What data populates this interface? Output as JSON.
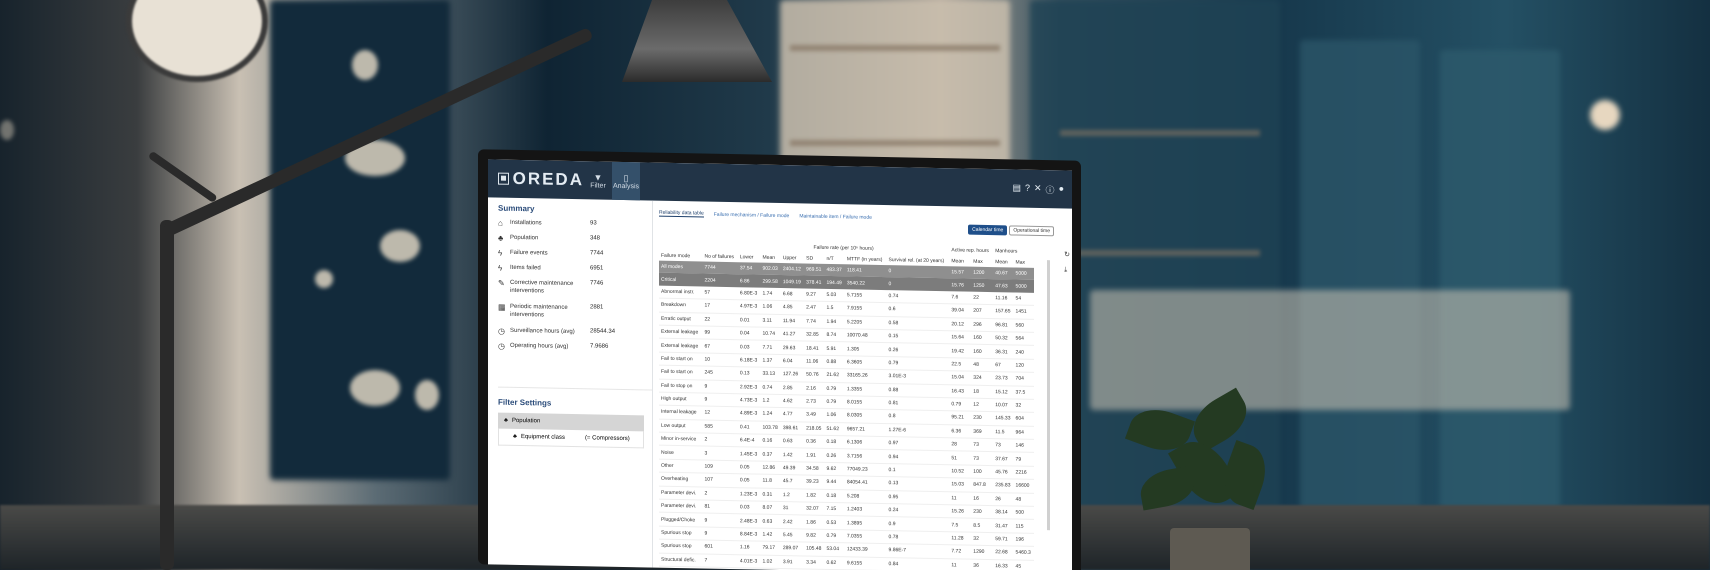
{
  "app": {
    "logo_text": "OREDA"
  },
  "nav": [
    {
      "label": "Filter",
      "icon": "filter-icon",
      "active": false
    },
    {
      "label": "Analysis",
      "icon": "analysis-icon",
      "active": true
    }
  ],
  "summary": {
    "title": "Summary",
    "items": [
      {
        "label": "Installations",
        "value": "93",
        "icon": "installation-icon"
      },
      {
        "label": "Population",
        "value": "348",
        "icon": "population-icon"
      },
      {
        "label": "Failure events",
        "value": "7744",
        "icon": "lightning-icon"
      },
      {
        "label": "Items failed",
        "value": "6951",
        "icon": "lightning-icon"
      },
      {
        "label": "Corrective maintenance interventions",
        "value": "7746",
        "icon": "wrench-icon"
      },
      {
        "label": "Periodic maintenance interventions",
        "value": "2881",
        "icon": "calendar-icon"
      },
      {
        "label": "Surveillance hours (avg)",
        "value": "28544.34",
        "icon": "clock-icon"
      },
      {
        "label": "Operating hours (avg)",
        "value": "7.9686",
        "icon": "clock-icon"
      }
    ]
  },
  "filter_settings": {
    "title": "Filter Settings",
    "item": "Population",
    "sub_label": "Equipment class",
    "sub_value": "(= Compressors)"
  },
  "tabs": [
    "Reliability data table",
    "Failure mechanism / Failure mode",
    "Maintainable item / Failure mode"
  ],
  "buttons": {
    "primary": "Calendar time",
    "secondary": "Operational time"
  },
  "table": {
    "group_header": "Failure rate (per 10⁶ hours)",
    "active_rep_label": "Active rep. hours",
    "manhours_label": "Manhours",
    "columns": [
      "Failure mode",
      "No of failures",
      "Lower",
      "Mean",
      "Upper",
      "SD",
      "n/T",
      "MTTF (in years)",
      "Survival rel. (at 20 years)",
      "Mean",
      "Max",
      "Mean",
      "Max"
    ],
    "group_rows": [
      [
        "All modes",
        "7744",
        "37.54",
        "902.03",
        "2404.12",
        "969.51",
        "483.37",
        "118.41",
        "0",
        "15.57",
        "1200",
        "40.67",
        "5000"
      ],
      [
        "Critical",
        "2204",
        "6.86",
        "299.58",
        "1049.19",
        "378.41",
        "194.49",
        "3540.22",
        "0",
        "15.76",
        "1250",
        "47.63",
        "5000"
      ]
    ],
    "rows": [
      [
        "Abnormal instr.",
        "57",
        "6.80E-3",
        "1.74",
        "6.68",
        "9.27",
        "5.03",
        "5.7155",
        "0.74",
        "7.6",
        "22",
        "11.16",
        "54"
      ],
      [
        "Breakdown",
        "17",
        "4.97E-3",
        "1.06",
        "4.85",
        "2.47",
        "1.5",
        "7.9155",
        "0.6",
        "39.04",
        "207",
        "157.65",
        "1451"
      ],
      [
        "Erratic output",
        "22",
        "0.01",
        "3.11",
        "11.94",
        "7.74",
        "1.94",
        "5.2205",
        "0.58",
        "20.12",
        "296",
        "96.81",
        "560"
      ],
      [
        "External leakage",
        "99",
        "0.04",
        "10.74",
        "41.27",
        "32.85",
        "8.74",
        "10070.48",
        "0.15",
        "15.64",
        "160",
        "50.32",
        "564"
      ],
      [
        "External leakage",
        "67",
        "0.03",
        "7.71",
        "29.63",
        "18.41",
        "5.91",
        "1.305",
        "0.26",
        "19.42",
        "160",
        "36.31",
        "240"
      ],
      [
        "Fail to start on",
        "10",
        "6.18E-3",
        "1.37",
        "6.04",
        "11.06",
        "0.88",
        "6.3605",
        "0.79",
        "22.5",
        "48",
        "67",
        "120"
      ],
      [
        "Fail to start on",
        "245",
        "0.13",
        "33.13",
        "127.26",
        "50.76",
        "21.62",
        "33165.26",
        "3.01E-3",
        "15.04",
        "324",
        "23.73",
        "704"
      ],
      [
        "Fail to stop on",
        "9",
        "2.92E-3",
        "0.74",
        "2.85",
        "2.16",
        "0.79",
        "1.3355",
        "0.88",
        "16.43",
        "18",
        "15.12",
        "37.5"
      ],
      [
        "High output",
        "9",
        "4.73E-3",
        "1.2",
        "4.62",
        "2.73",
        "0.79",
        "8.0155",
        "0.81",
        "0.79",
        "12",
        "10.07",
        "32"
      ],
      [
        "Internal leakage",
        "12",
        "4.89E-3",
        "1.24",
        "4.77",
        "3.49",
        "1.06",
        "8.0305",
        "0.8",
        "95.21",
        "230",
        "145.33",
        "604"
      ],
      [
        "Low output",
        "585",
        "0.41",
        "103.78",
        "398.61",
        "218.05",
        "51.62",
        "9657.21",
        "1.27E-6",
        "6.36",
        "369",
        "11.5",
        "964"
      ],
      [
        "Minor in-service",
        "2",
        "6.4E-4",
        "0.16",
        "0.63",
        "0.36",
        "0.18",
        "6.1306",
        "0.97",
        "28",
        "73",
        "73",
        "146"
      ],
      [
        "Noise",
        "3",
        "1.45E-3",
        "0.37",
        "1.42",
        "1.91",
        "0.26",
        "3.7156",
        "0.94",
        "51",
        "73",
        "37.67",
        "79"
      ],
      [
        "Other",
        "109",
        "0.05",
        "12.86",
        "49.39",
        "34.58",
        "9.62",
        "77049.23",
        "0.1",
        "10.52",
        "100",
        "45.76",
        "2216"
      ],
      [
        "Overheating",
        "107",
        "0.05",
        "11.8",
        "45.7",
        "39.23",
        "9.44",
        "84054.41",
        "0.13",
        "15.03",
        "847.8",
        "235.83",
        "16600"
      ],
      [
        "Parameter devi.",
        "2",
        "1.23E-3",
        "0.31",
        "1.2",
        "1.82",
        "0.18",
        "5.208",
        "0.95",
        "11",
        "16",
        "26",
        "48"
      ],
      [
        "Parameter devi.",
        "81",
        "0.03",
        "8.07",
        "31",
        "32.07",
        "7.15",
        "1.2403",
        "0.24",
        "15.26",
        "230",
        "38.14",
        "500"
      ],
      [
        "Plugged/Choke",
        "9",
        "2.48E-3",
        "0.63",
        "2.42",
        "1.86",
        "0.53",
        "1.3895",
        "0.9",
        "7.5",
        "8.5",
        "31.47",
        "115"
      ],
      [
        "Spurious stop",
        "9",
        "8.84E-3",
        "1.42",
        "5.45",
        "9.82",
        "0.79",
        "7.0355",
        "0.78",
        "11.28",
        "32",
        "59.71",
        "196"
      ],
      [
        "Spurious stop",
        "601",
        "1.16",
        "79.17",
        "289.07",
        "105.48",
        "53.04",
        "12433.39",
        "9.86E-7",
        "7.72",
        "1290",
        "22.68",
        "5460.3"
      ],
      [
        "Structural defic.",
        "7",
        "4.01E-3",
        "1.02",
        "3.91",
        "3.34",
        "0.62",
        "9.6155",
        "0.84",
        "11",
        "36",
        "16.33",
        "45"
      ]
    ]
  },
  "colors": {
    "topbar": "#223447",
    "accent": "#1f4f8a",
    "title_blue": "#2b4c7a",
    "group_row": "#8f8f8f"
  }
}
